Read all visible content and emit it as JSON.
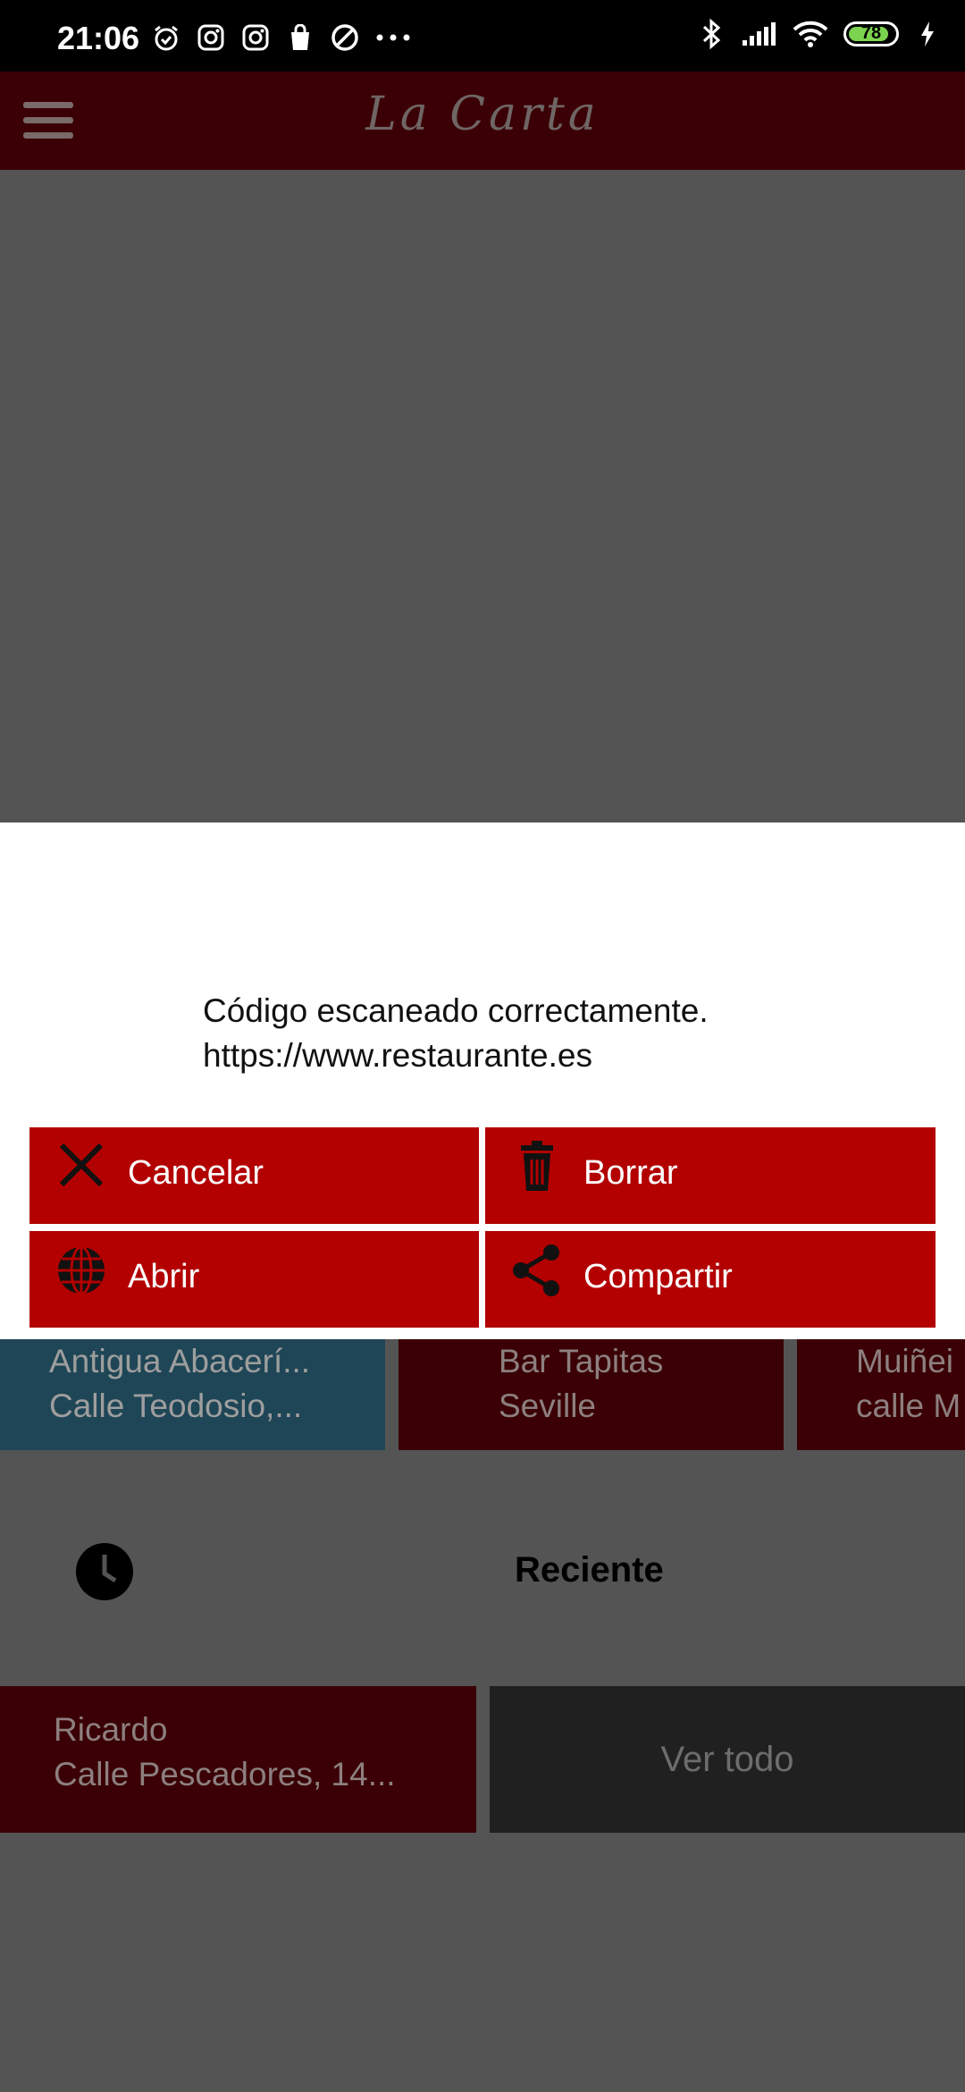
{
  "status_bar": {
    "time": "21:06",
    "battery": "78",
    "battery_color": "#7cd34f"
  },
  "app_bar": {
    "title": "La Carta"
  },
  "dialog": {
    "message_line1": "Código escaneado correctamente.",
    "message_line2": "https://www.restaurante.es",
    "buttons": {
      "cancel": "Cancelar",
      "delete": "Borrar",
      "open": "Abrir",
      "share": "Compartir"
    },
    "button_color": "#b30000"
  },
  "cards": [
    {
      "name": "Antigua Abacerí...",
      "address": "Calle Teodosio,..."
    },
    {
      "name": "Bar Tapitas",
      "address": "Seville"
    },
    {
      "name": "Muiñei",
      "address": "calle M"
    }
  ],
  "recent": {
    "label": "Reciente",
    "items": [
      {
        "name": "Ricardo",
        "address": "Calle Pescadores, 14..."
      }
    ],
    "see_all": "Ver todo"
  }
}
